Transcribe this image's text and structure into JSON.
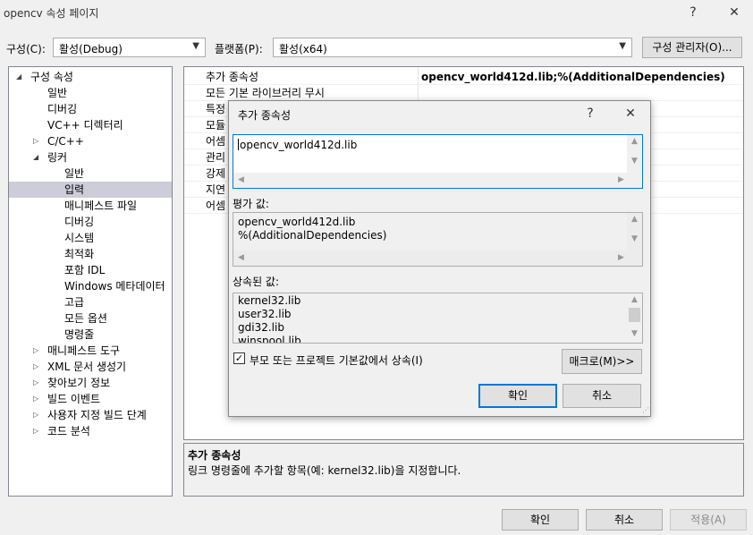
{
  "window": {
    "title": "opencv 속성 페이지",
    "help_glyph": "?",
    "close_glyph": "✕"
  },
  "config": {
    "config_label": "구성(C):",
    "config_value": "활성(Debug)",
    "platform_label": "플랫폼(P):",
    "platform_value": "활성(x64)",
    "manager_button": "구성 관리자(O)..."
  },
  "tree": {
    "items": [
      {
        "label": "구성 속성",
        "glyph": "◢"
      },
      {
        "label": "일반"
      },
      {
        "label": "디버깅"
      },
      {
        "label": "VC++ 디렉터리"
      },
      {
        "label": "C/C++",
        "glyph": "▷"
      },
      {
        "label": "링커",
        "glyph": "◢"
      },
      {
        "label": "일반"
      },
      {
        "label": "입력"
      },
      {
        "label": "매니페스트 파일"
      },
      {
        "label": "디버깅"
      },
      {
        "label": "시스템"
      },
      {
        "label": "최적화"
      },
      {
        "label": "포함 IDL"
      },
      {
        "label": "Windows 메타데이터"
      },
      {
        "label": "고급"
      },
      {
        "label": "모든 옵션"
      },
      {
        "label": "명령줄"
      },
      {
        "label": "매니페스트 도구",
        "glyph": "▷"
      },
      {
        "label": "XML 문서 생성기",
        "glyph": "▷"
      },
      {
        "label": "찾아보기 정보",
        "glyph": "▷"
      },
      {
        "label": "빌드 이벤트",
        "glyph": "▷"
      },
      {
        "label": "사용자 지정 빌드 단계",
        "glyph": "▷"
      },
      {
        "label": "코드 분석",
        "glyph": "▷"
      }
    ]
  },
  "grid": {
    "rows": [
      {
        "name": "추가 종속성",
        "value": "opencv_world412d.lib;%(AdditionalDependencies)"
      },
      {
        "name": "모든 기본 라이브러리 무시",
        "value": ""
      },
      {
        "name": "특정",
        "value": ""
      },
      {
        "name": "모듈",
        "value": ""
      },
      {
        "name": "어셈",
        "value": ""
      },
      {
        "name": "관리",
        "value": ""
      },
      {
        "name": "강제",
        "value": ""
      },
      {
        "name": "지연",
        "value": ""
      },
      {
        "name": "어셈",
        "value": ""
      }
    ]
  },
  "description": {
    "title": "추가 종속성",
    "text": "링크 명령줄에 추가할 항목(예: kernel32.lib)을 지정합니다."
  },
  "dialog": {
    "title": "추가 종속성",
    "help_glyph": "?",
    "close_glyph": "✕",
    "edit_text": "opencv_world412d.lib",
    "evaluated_label": "평가 값:",
    "evaluated_lines": [
      "opencv_world412d.lib",
      "%(AdditionalDependencies)"
    ],
    "inherited_label": "상속된 값:",
    "inherited_lines": [
      "kernel32.lib",
      "user32.lib",
      "gdi32.lib",
      "winspool.lib"
    ],
    "inherit_checkbox_label": "부모 또는 프로젝트 기본값에서 상속(I)",
    "inherit_checked": true,
    "macro_button": "매크로(M)>>",
    "ok_button": "확인",
    "cancel_button": "취소"
  },
  "footer": {
    "ok_button": "확인",
    "cancel_button": "취소",
    "apply_button": "적용(A)"
  }
}
